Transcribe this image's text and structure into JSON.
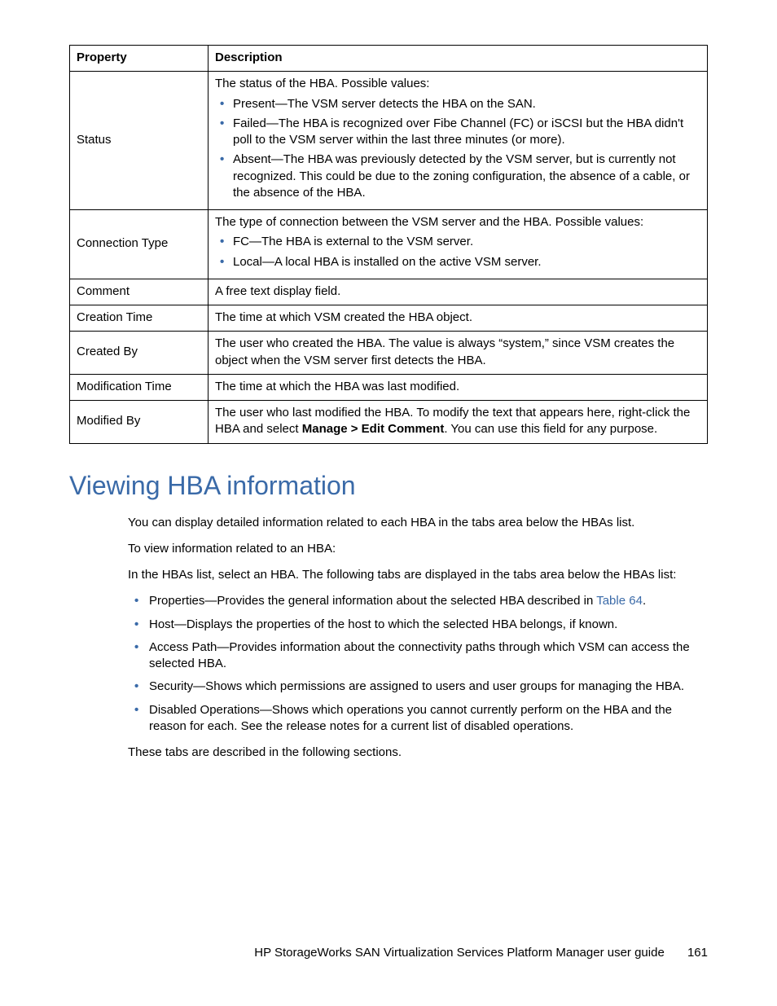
{
  "table": {
    "headers": {
      "col1": "Property",
      "col2": "Description"
    },
    "rows": {
      "status": {
        "prop": "Status",
        "lead": "The status of the HBA. Possible values:",
        "items": {
          "0": "Present—The VSM server detects the HBA on the SAN.",
          "1": "Failed—The HBA is recognized over Fibe Channel (FC) or iSCSI but the HBA didn't poll to the VSM server within the last three minutes (or more).",
          "2": "Absent—The HBA was previously detected by the VSM server, but is currently not recognized. This could be due to the zoning configuration, the absence of a cable, or the absence of the HBA."
        }
      },
      "conn": {
        "prop": "Connection Type",
        "lead": "The type of connection between the VSM server and the HBA. Possible values:",
        "items": {
          "0": "FC—The HBA is external to the VSM server.",
          "1": "Local—A local HBA is installed on the active VSM server."
        }
      },
      "comment": {
        "prop": "Comment",
        "desc": "A free text display field."
      },
      "ctime": {
        "prop": "Creation Time",
        "desc": "The time at which VSM created the HBA object."
      },
      "cby": {
        "prop": "Created By",
        "desc": "The user who created the HBA. The value is always “system,” since VSM creates the object when the VSM server first detects the HBA."
      },
      "mtime": {
        "prop": "Modification Time",
        "desc": "The time at which the HBA was last modified."
      },
      "mby": {
        "prop": "Modified By",
        "desc_pre": "The user who last modified the HBA. To modify the text that appears here, right-click the HBA and select ",
        "desc_bold": "Manage > Edit Comment",
        "desc_post": ". You can use this field for any purpose."
      }
    }
  },
  "section": {
    "heading": "Viewing HBA information",
    "p1": "You can display detailed information related to each HBA in the tabs area below the HBAs list.",
    "p2": "To view information related to an HBA:",
    "p3": "In the HBAs list, select an HBA. The following tabs are displayed in the tabs area below the HBAs list:",
    "bullets": {
      "0_pre": "Properties—Provides the general information about the selected HBA described in ",
      "0_link": "Table 64",
      "0_post": ".",
      "1": "Host—Displays the properties of the host to which the selected HBA belongs, if known.",
      "2": "Access Path—Provides information about the connectivity paths through which VSM can access the selected HBA.",
      "3": "Security—Shows which permissions are assigned to users and user groups for managing the HBA.",
      "4": "Disabled Operations—Shows which operations you cannot currently perform on the HBA and the reason for each. See the release notes for a current list of disabled operations."
    },
    "p_after": "These tabs are described in the following sections."
  },
  "footer": {
    "title": "HP StorageWorks SAN Virtualization Services Platform Manager user guide",
    "page": "161"
  }
}
